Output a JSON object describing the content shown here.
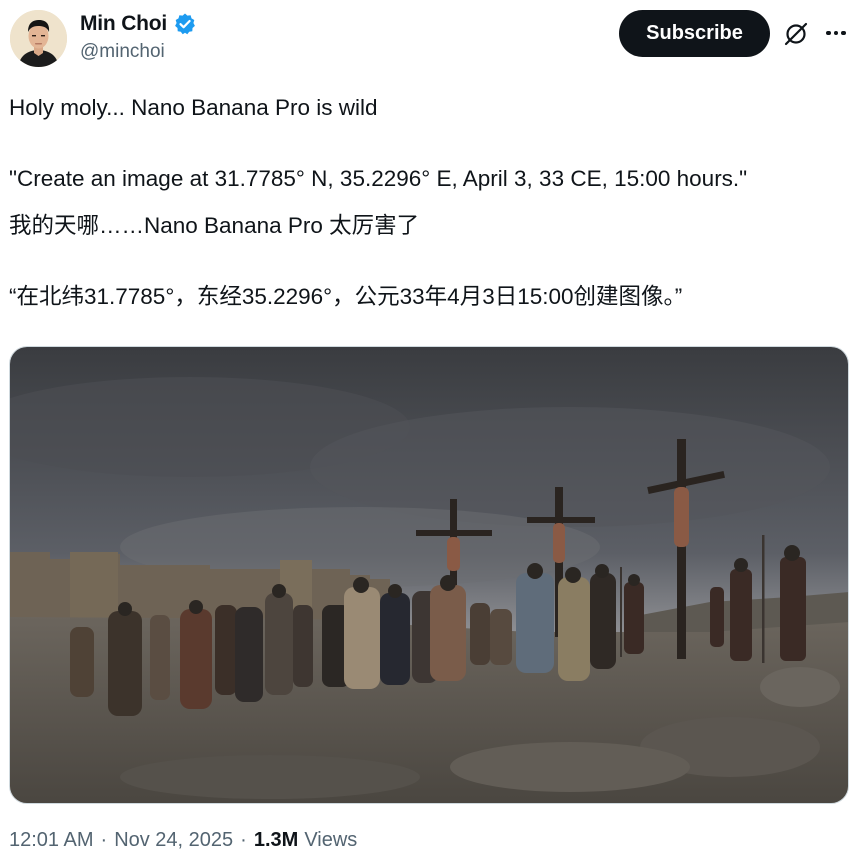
{
  "author": {
    "display_name": "Min Choi",
    "handle": "@minchoi",
    "verified": true,
    "verified_color": "#1d9bf0",
    "avatar_icon": "avatar-photo"
  },
  "actions": {
    "subscribe_label": "Subscribe",
    "grok_icon": "grok-icon",
    "more_icon": "more-icon"
  },
  "tweet": {
    "lines": [
      "Holy moly... Nano Banana Pro is wild",
      "\"Create an image at 31.7785° N, 35.2296° E, April 3, 33 CE, 15:00 hours.\"",
      "我的天哪……Nano Banana Pro 太厉害了",
      "“在北纬31.7785°，东经35.2296°，公元33年4月3日15:00创建图像。”"
    ]
  },
  "media": {
    "alt": "Image",
    "type": "photo"
  },
  "meta": {
    "time": "12:01 AM",
    "date": "Nov 24, 2025",
    "views_count": "1.3M",
    "views_label": "Views"
  }
}
